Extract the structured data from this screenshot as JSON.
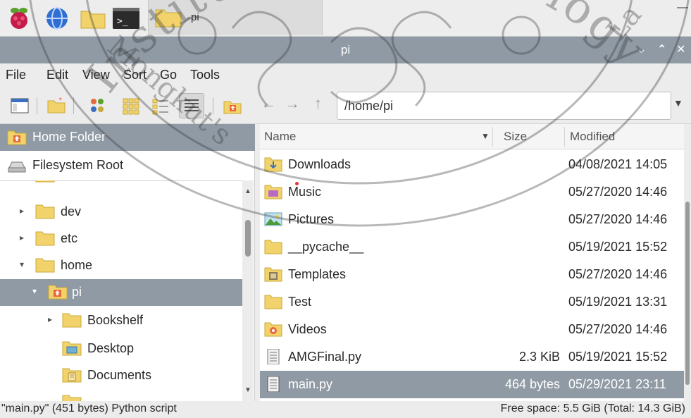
{
  "taskbar": {
    "icons": [
      "raspberry-pi-menu-icon",
      "web-browser-icon",
      "file-manager-icon",
      "terminal-icon"
    ],
    "window_title": "pi"
  },
  "window": {
    "title": "pi",
    "controls": [
      "minimize",
      "maximize",
      "close"
    ]
  },
  "menu": [
    "File",
    "Edit",
    "View",
    "Sort",
    "Go",
    "Tools"
  ],
  "toolbar": {
    "icons": [
      "new-window-icon",
      "new-folder-icon",
      "icon-view-icon",
      "thumbnail-view-icon",
      "compact-view-icon",
      "list-view-icon",
      "home-icon"
    ],
    "path_value": "/home/pi"
  },
  "places": [
    {
      "label": "Home Folder",
      "icon": "home-folder-icon",
      "selected": true
    },
    {
      "label": "Filesystem Root",
      "icon": "drive-icon",
      "selected": false
    }
  ],
  "tree": [
    {
      "label": "dev",
      "expander": "▸",
      "selected": false
    },
    {
      "label": "etc",
      "expander": "▸",
      "selected": false
    },
    {
      "label": "home",
      "expander": "▾",
      "selected": false
    },
    {
      "label": "pi",
      "expander": "▾",
      "selected": true
    },
    {
      "label": "Bookshelf",
      "expander": "▸",
      "selected": false
    },
    {
      "label": "Desktop",
      "expander": "",
      "selected": false
    },
    {
      "label": "Documents",
      "expander": "",
      "selected": false
    }
  ],
  "columns": {
    "name": "Name",
    "size": "Size",
    "modified": "Modified"
  },
  "files": [
    {
      "name": "Downloads",
      "size": "",
      "modified": "04/08/2021 14:05",
      "icon": "downloads-folder-icon",
      "selected": false
    },
    {
      "name": "Music",
      "size": "",
      "modified": "05/27/2020 14:46",
      "icon": "music-folder-icon",
      "selected": false
    },
    {
      "name": "Pictures",
      "size": "",
      "modified": "05/27/2020 14:46",
      "icon": "pictures-folder-icon",
      "selected": false
    },
    {
      "name": "__pycache__",
      "size": "",
      "modified": "05/19/2021 15:52",
      "icon": "folder-icon",
      "selected": false
    },
    {
      "name": "Templates",
      "size": "",
      "modified": "05/27/2020 14:46",
      "icon": "templates-folder-icon",
      "selected": false
    },
    {
      "name": "Test",
      "size": "",
      "modified": "05/19/2021 13:31",
      "icon": "folder-icon",
      "selected": false
    },
    {
      "name": "Videos",
      "size": "",
      "modified": "05/27/2020 14:46",
      "icon": "videos-folder-icon",
      "selected": false
    },
    {
      "name": "AMGFinal.py",
      "size": "2.3 KiB",
      "modified": "05/19/2021 15:52",
      "icon": "text-file-icon",
      "selected": false
    },
    {
      "name": "main.py",
      "size": "464 bytes",
      "modified": "05/29/2021 23:11",
      "icon": "text-file-icon",
      "selected": true
    }
  ],
  "status": {
    "left": "\"main.py\" (451 bytes) Python script",
    "right": "Free space: 5.5 GiB (Total: 14.3 GiB)"
  },
  "watermark": {
    "left_text": "Mongkut's",
    "main_text": "Institute of Technology",
    "right_text": "La"
  },
  "colors": {
    "selection": "#8f9aa5",
    "folder": "#f2d36b",
    "home_badge": "#e8683a"
  }
}
